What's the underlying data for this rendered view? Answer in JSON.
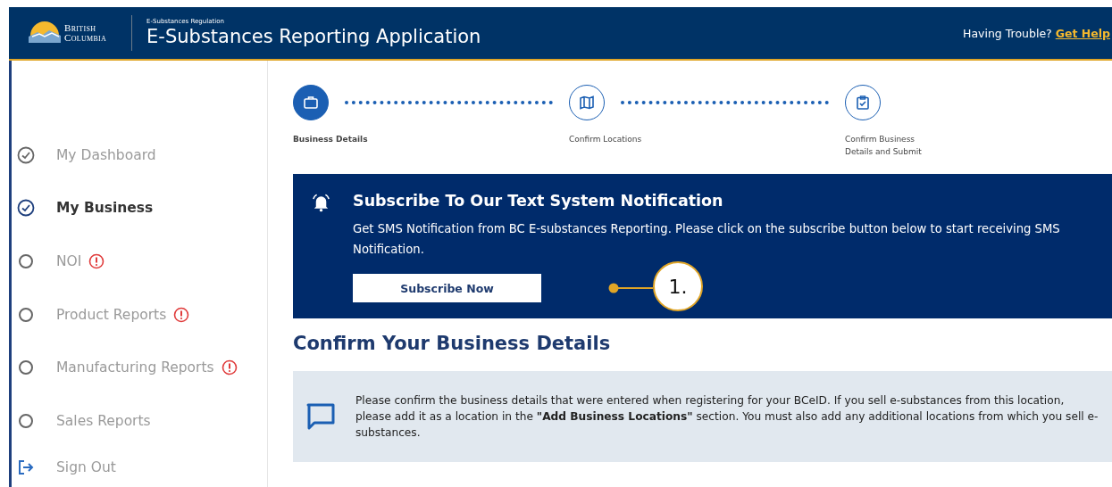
{
  "header": {
    "logo_text": [
      "British",
      "Columbia"
    ],
    "subtitle": "E-Substances Regulation",
    "title": "E-Substances Reporting Application",
    "help_prompt": "Having Trouble?",
    "help_link": "Get Help"
  },
  "sidebar": {
    "items": [
      {
        "label": "My Dashboard",
        "kind": "check",
        "selected": false,
        "alert": false
      },
      {
        "label": "My Business",
        "kind": "check",
        "selected": true,
        "alert": false
      },
      {
        "label": "NOI",
        "kind": "circle",
        "selected": false,
        "alert": true
      },
      {
        "label": "Product Reports",
        "kind": "circle",
        "selected": false,
        "alert": true
      },
      {
        "label": "Manufacturing Reports",
        "kind": "circle",
        "selected": false,
        "alert": true
      },
      {
        "label": "Sales Reports",
        "kind": "circle",
        "selected": false,
        "alert": false
      },
      {
        "label": "Sign Out",
        "kind": "signout",
        "selected": false,
        "alert": false
      }
    ]
  },
  "steps": [
    {
      "label": "Business Details",
      "kind": "briefcase",
      "selected": true
    },
    {
      "label": "Confirm Locations",
      "kind": "map",
      "selected": false
    },
    {
      "label": "Confirm Business Details and Submit",
      "kind": "clipboard",
      "selected": false
    }
  ],
  "notification": {
    "title": "Subscribe To Our Text System Notification",
    "text": "Get SMS Notification from BC E-substances Reporting. Please click on the subscribe button below to start receiving SMS Notification.",
    "button": "Subscribe Now",
    "callout": "1."
  },
  "section_title": "Confirm Your Business Details",
  "info": {
    "text": "Please confirm the business details that were entered when registering for your BCeID. If you sell e-substances from this location, please add it as a location in the **\"Add Business Locations\"** section. You must also add any additional locations from which you sell e-substances."
  }
}
